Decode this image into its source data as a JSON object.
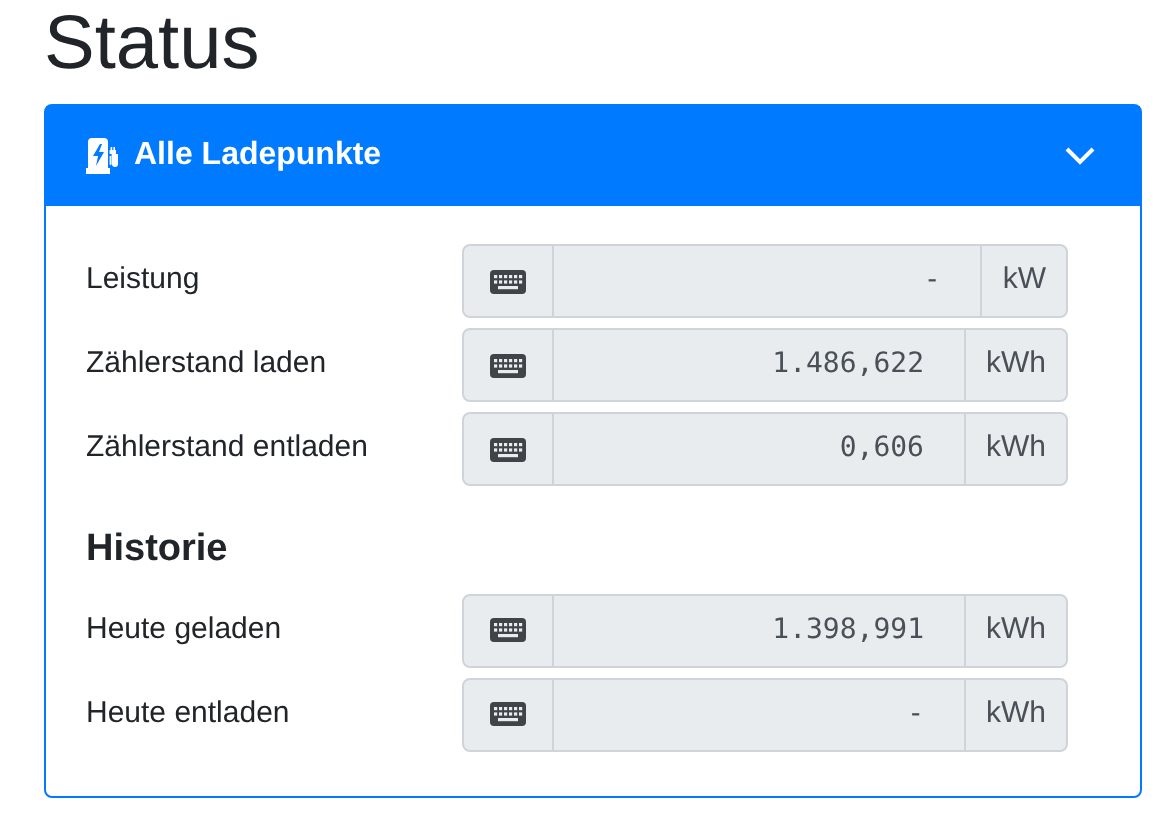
{
  "page_title": "Status",
  "card": {
    "title": "Alle Ladepunkte",
    "expanded": true
  },
  "sections": [
    {
      "rows": [
        {
          "label": "Leistung",
          "value": "-",
          "unit": "kW"
        },
        {
          "label": "Zählerstand laden",
          "value": "1.486,622",
          "unit": "kWh"
        },
        {
          "label": "Zählerstand entladen",
          "value": "0,606",
          "unit": "kWh"
        }
      ]
    },
    {
      "heading": "Historie",
      "rows": [
        {
          "label": "Heute geladen",
          "value": "1.398,991",
          "unit": "kWh"
        },
        {
          "label": "Heute entladen",
          "value": "-",
          "unit": "kWh"
        }
      ]
    }
  ]
}
